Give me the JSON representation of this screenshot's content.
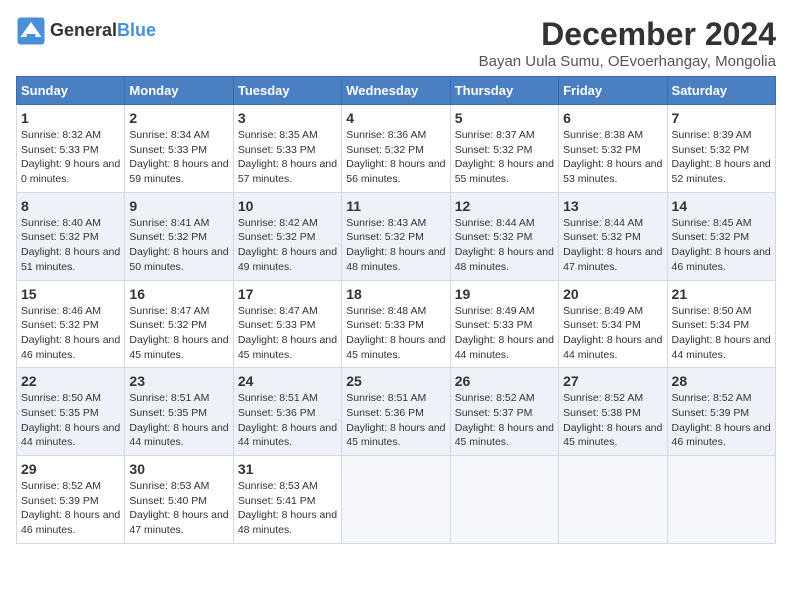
{
  "logo": {
    "general": "General",
    "blue": "Blue"
  },
  "header": {
    "month_title": "December 2024",
    "subtitle": "Bayan Uula Sumu, OEvoerhangay, Mongolia"
  },
  "weekdays": [
    "Sunday",
    "Monday",
    "Tuesday",
    "Wednesday",
    "Thursday",
    "Friday",
    "Saturday"
  ],
  "weeks": [
    [
      {
        "day": "1",
        "sunrise": "8:32 AM",
        "sunset": "5:33 PM",
        "daylight": "9 hours and 0 minutes."
      },
      {
        "day": "2",
        "sunrise": "8:34 AM",
        "sunset": "5:33 PM",
        "daylight": "8 hours and 59 minutes."
      },
      {
        "day": "3",
        "sunrise": "8:35 AM",
        "sunset": "5:33 PM",
        "daylight": "8 hours and 57 minutes."
      },
      {
        "day": "4",
        "sunrise": "8:36 AM",
        "sunset": "5:32 PM",
        "daylight": "8 hours and 56 minutes."
      },
      {
        "day": "5",
        "sunrise": "8:37 AM",
        "sunset": "5:32 PM",
        "daylight": "8 hours and 55 minutes."
      },
      {
        "day": "6",
        "sunrise": "8:38 AM",
        "sunset": "5:32 PM",
        "daylight": "8 hours and 53 minutes."
      },
      {
        "day": "7",
        "sunrise": "8:39 AM",
        "sunset": "5:32 PM",
        "daylight": "8 hours and 52 minutes."
      }
    ],
    [
      {
        "day": "8",
        "sunrise": "8:40 AM",
        "sunset": "5:32 PM",
        "daylight": "8 hours and 51 minutes."
      },
      {
        "day": "9",
        "sunrise": "8:41 AM",
        "sunset": "5:32 PM",
        "daylight": "8 hours and 50 minutes."
      },
      {
        "day": "10",
        "sunrise": "8:42 AM",
        "sunset": "5:32 PM",
        "daylight": "8 hours and 49 minutes."
      },
      {
        "day": "11",
        "sunrise": "8:43 AM",
        "sunset": "5:32 PM",
        "daylight": "8 hours and 48 minutes."
      },
      {
        "day": "12",
        "sunrise": "8:44 AM",
        "sunset": "5:32 PM",
        "daylight": "8 hours and 48 minutes."
      },
      {
        "day": "13",
        "sunrise": "8:44 AM",
        "sunset": "5:32 PM",
        "daylight": "8 hours and 47 minutes."
      },
      {
        "day": "14",
        "sunrise": "8:45 AM",
        "sunset": "5:32 PM",
        "daylight": "8 hours and 46 minutes."
      }
    ],
    [
      {
        "day": "15",
        "sunrise": "8:46 AM",
        "sunset": "5:32 PM",
        "daylight": "8 hours and 46 minutes."
      },
      {
        "day": "16",
        "sunrise": "8:47 AM",
        "sunset": "5:32 PM",
        "daylight": "8 hours and 45 minutes."
      },
      {
        "day": "17",
        "sunrise": "8:47 AM",
        "sunset": "5:33 PM",
        "daylight": "8 hours and 45 minutes."
      },
      {
        "day": "18",
        "sunrise": "8:48 AM",
        "sunset": "5:33 PM",
        "daylight": "8 hours and 45 minutes."
      },
      {
        "day": "19",
        "sunrise": "8:49 AM",
        "sunset": "5:33 PM",
        "daylight": "8 hours and 44 minutes."
      },
      {
        "day": "20",
        "sunrise": "8:49 AM",
        "sunset": "5:34 PM",
        "daylight": "8 hours and 44 minutes."
      },
      {
        "day": "21",
        "sunrise": "8:50 AM",
        "sunset": "5:34 PM",
        "daylight": "8 hours and 44 minutes."
      }
    ],
    [
      {
        "day": "22",
        "sunrise": "8:50 AM",
        "sunset": "5:35 PM",
        "daylight": "8 hours and 44 minutes."
      },
      {
        "day": "23",
        "sunrise": "8:51 AM",
        "sunset": "5:35 PM",
        "daylight": "8 hours and 44 minutes."
      },
      {
        "day": "24",
        "sunrise": "8:51 AM",
        "sunset": "5:36 PM",
        "daylight": "8 hours and 44 minutes."
      },
      {
        "day": "25",
        "sunrise": "8:51 AM",
        "sunset": "5:36 PM",
        "daylight": "8 hours and 45 minutes."
      },
      {
        "day": "26",
        "sunrise": "8:52 AM",
        "sunset": "5:37 PM",
        "daylight": "8 hours and 45 minutes."
      },
      {
        "day": "27",
        "sunrise": "8:52 AM",
        "sunset": "5:38 PM",
        "daylight": "8 hours and 45 minutes."
      },
      {
        "day": "28",
        "sunrise": "8:52 AM",
        "sunset": "5:39 PM",
        "daylight": "8 hours and 46 minutes."
      }
    ],
    [
      {
        "day": "29",
        "sunrise": "8:52 AM",
        "sunset": "5:39 PM",
        "daylight": "8 hours and 46 minutes."
      },
      {
        "day": "30",
        "sunrise": "8:53 AM",
        "sunset": "5:40 PM",
        "daylight": "8 hours and 47 minutes."
      },
      {
        "day": "31",
        "sunrise": "8:53 AM",
        "sunset": "5:41 PM",
        "daylight": "8 hours and 48 minutes."
      },
      null,
      null,
      null,
      null
    ]
  ]
}
